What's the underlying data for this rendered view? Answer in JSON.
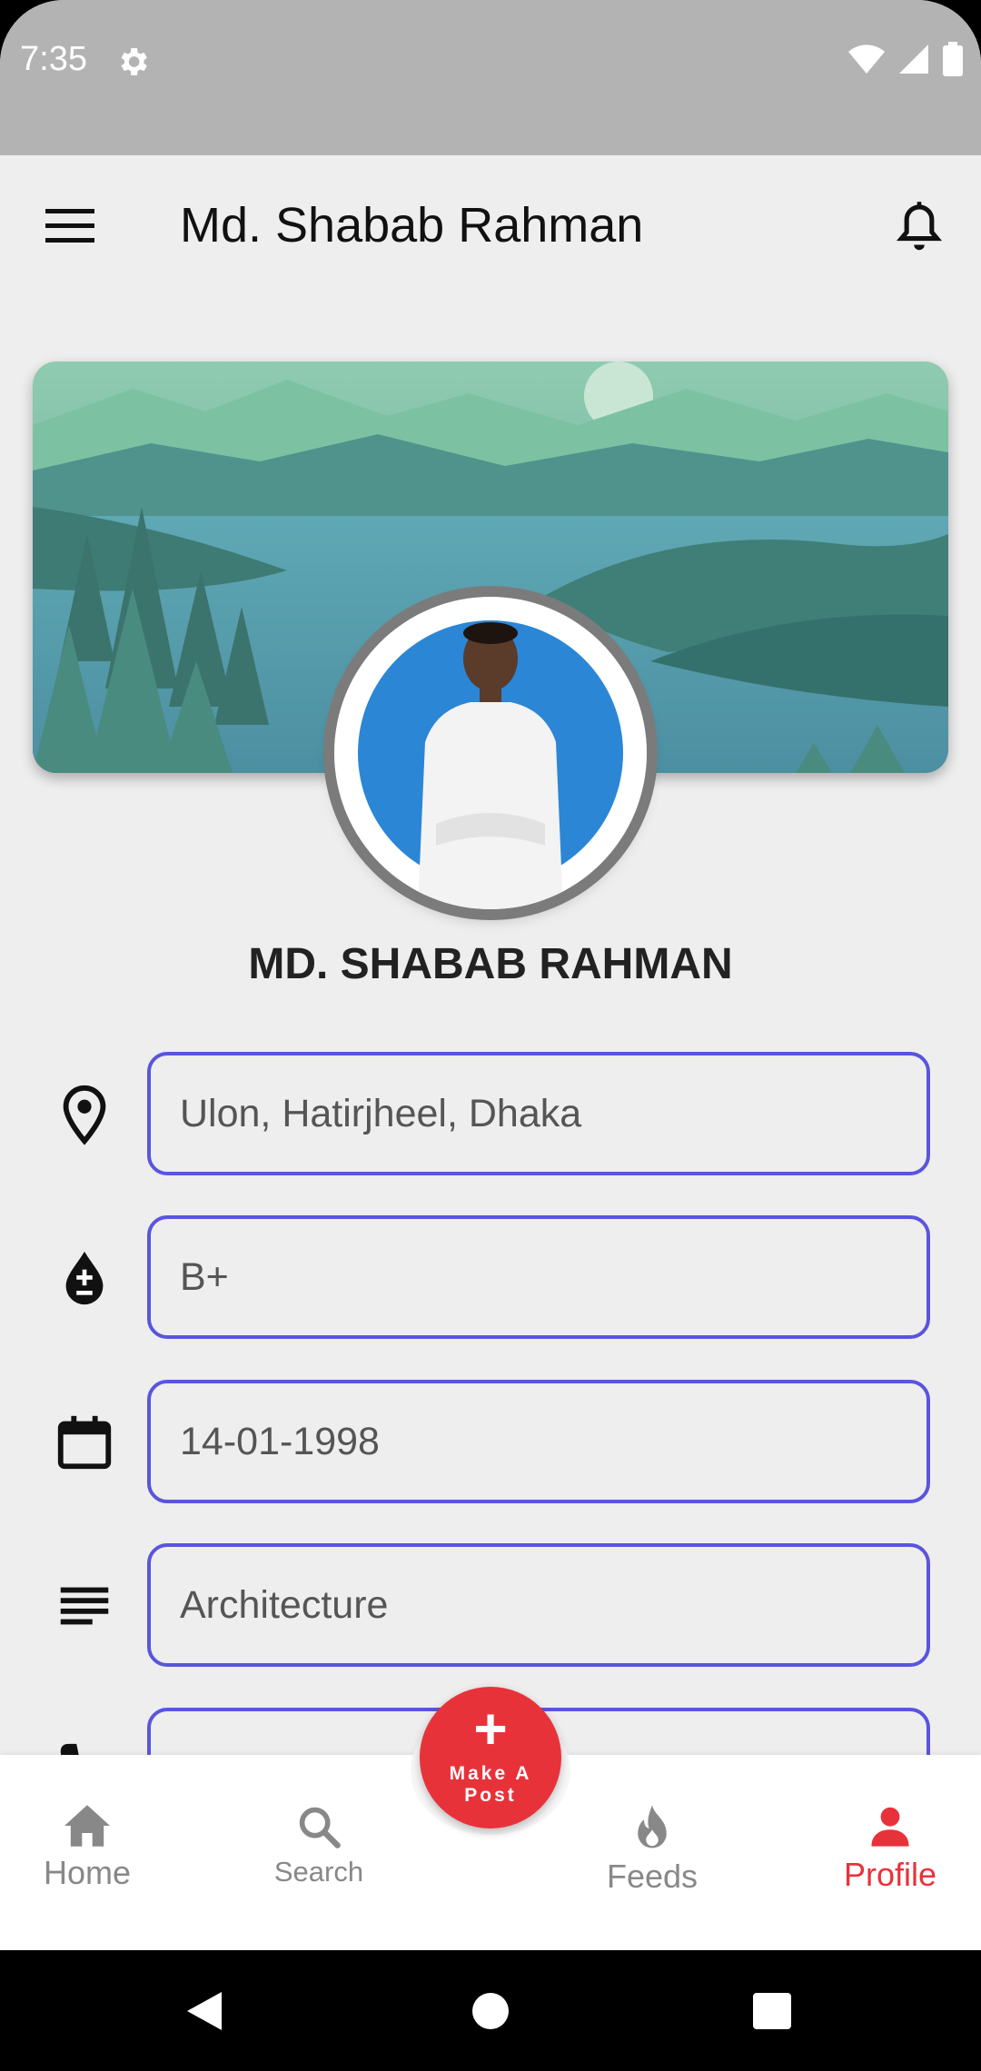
{
  "status_bar": {
    "time": "7:35"
  },
  "app_bar": {
    "title": "Md. Shabab Rahman"
  },
  "profile": {
    "name": "MD. SHABAB RAHMAN",
    "fields": [
      {
        "icon": "location-pin-icon",
        "value": "Ulon, Hatirjheel, Dhaka"
      },
      {
        "icon": "blood-drop-icon",
        "value": "B+"
      },
      {
        "icon": "calendar-icon",
        "value": "14-01-1998"
      },
      {
        "icon": "notes-icon",
        "value": "Architecture"
      },
      {
        "icon": "phone-icon",
        "value": ""
      }
    ]
  },
  "fab": {
    "plus": "+",
    "label_line1": "Make A",
    "label_line2": "Post"
  },
  "bottom_nav": {
    "items": [
      {
        "label": "Home",
        "icon": "home-icon",
        "active": false
      },
      {
        "label": "Search",
        "icon": "search-icon",
        "active": false
      },
      {
        "label": "Feeds",
        "icon": "flame-icon",
        "active": false
      },
      {
        "label": "Profile",
        "icon": "person-icon",
        "active": true
      }
    ]
  },
  "colors": {
    "accent": "#e8323a",
    "field_border": "#5a55dc",
    "background": "#eeeeee"
  }
}
